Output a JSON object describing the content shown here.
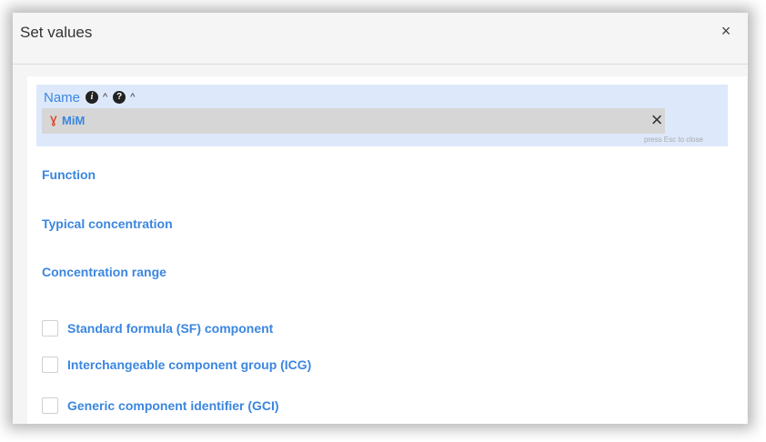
{
  "dialog": {
    "title": "Set values",
    "close_icon": "×"
  },
  "name_field": {
    "label": "Name",
    "info_icon_glyph": "i",
    "help_icon_glyph": "?",
    "caret_glyph": "^",
    "chip": {
      "symbol": "Ɣ",
      "text": "MiM"
    },
    "clear_glyph": "×",
    "esc_hint": "press Esc to close"
  },
  "fields": {
    "function": "Function",
    "typical_concentration": "Typical concentration",
    "concentration_range": "Concentration range"
  },
  "checkboxes": [
    {
      "label": "Standard formula (SF) component",
      "checked": false
    },
    {
      "label": "Interchangeable component group (ICG)",
      "checked": false
    },
    {
      "label": "Generic component identifier (GCI)",
      "checked": false
    }
  ],
  "colors": {
    "accent": "#3b86e0",
    "name_highlight": "#dde9fb",
    "chip_background": "#d6d6d6",
    "chip_symbol": "#e0452b"
  },
  "icons": {
    "info": "info-icon",
    "help": "help-icon",
    "caret": "caret-up-icon",
    "close": "close-icon",
    "clear": "clear-icon"
  }
}
